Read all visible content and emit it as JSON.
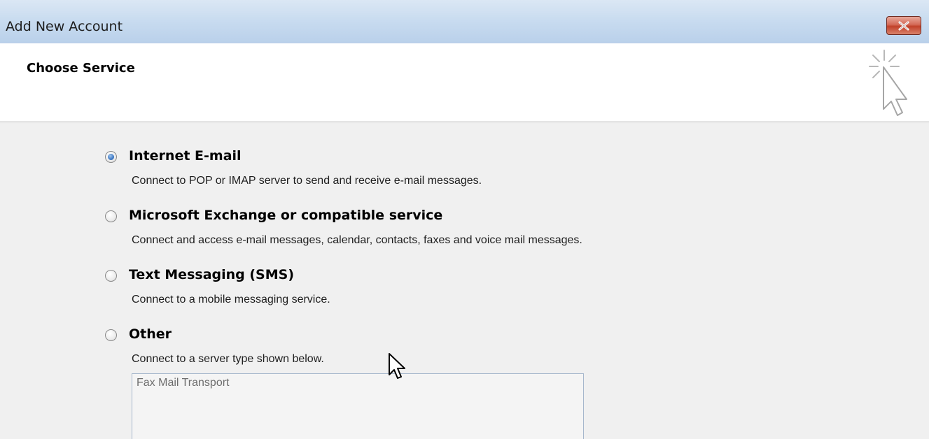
{
  "window": {
    "title": "Add New Account"
  },
  "icons": {
    "close": "close-icon",
    "header": "click-cursor-icon",
    "mouse": "mouse-pointer-icon"
  },
  "colors": {
    "titlebar": "#c9dcf0",
    "close_button": "#c1412a",
    "content_background": "#f0f0f0",
    "radio_selected": "#3d78c4"
  },
  "header": {
    "title": "Choose Service"
  },
  "options": [
    {
      "label": "Internet E-mail",
      "description": "Connect to POP or IMAP server to send and receive e-mail messages.",
      "selected": true
    },
    {
      "label": "Microsoft Exchange or compatible service",
      "description": "Connect and access e-mail messages, calendar, contacts, faxes and voice mail messages.",
      "selected": false
    },
    {
      "label": "Text Messaging (SMS)",
      "description": "Connect to a mobile messaging service.",
      "selected": false
    },
    {
      "label": "Other",
      "description": "Connect to a server type shown below.",
      "selected": false
    }
  ],
  "server_types": {
    "items": [
      "Fax Mail Transport"
    ]
  }
}
